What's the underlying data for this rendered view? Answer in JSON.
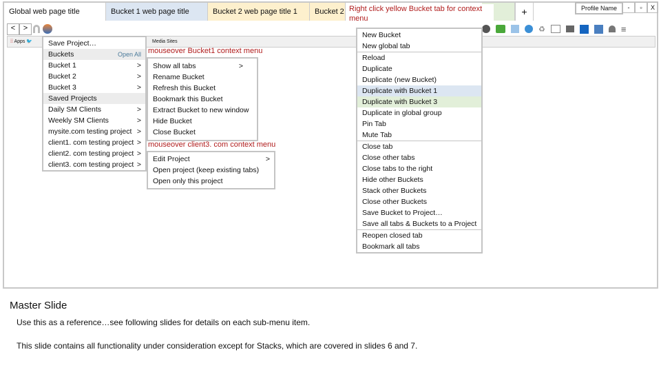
{
  "tabs": [
    {
      "label": "Global web page title",
      "color": "#ffffff"
    },
    {
      "label": "Bucket 1 web page title",
      "color": "#dce6f2"
    },
    {
      "label": "Bucket 2 web page title 1",
      "color": "#fdf0cd"
    },
    {
      "label": "Bucket 2",
      "color": "#fdf0cd"
    },
    {
      "label": "",
      "color": "#e2efd9"
    }
  ],
  "new_tab": "+",
  "window": {
    "profile": "Profile Name",
    "minimize": "-",
    "maximize": "▫",
    "close": "X"
  },
  "nav": {
    "back": "<",
    "forward": ">"
  },
  "bookmarks": {
    "apps": "Apps",
    "media": "Media Sites"
  },
  "notes": {
    "right_click": "Right click yellow Bucket tab for context menu",
    "bucket1": "mouseover Bucket1 context menu",
    "client3": "mouseover client3. com context menu"
  },
  "main_menu": {
    "save": "Save Project…",
    "buckets": "Buckets",
    "open_all": "Open All",
    "bucket_items": [
      "Bucket 1",
      "Bucket 2",
      "Bucket 3"
    ],
    "saved": "Saved Projects",
    "projects": [
      "Daily SM Clients",
      "Weekly SM Clients",
      "mysite.com testing project",
      "client1. com testing project",
      "client2. com testing project",
      "client3. com testing project"
    ],
    "arrow": ">"
  },
  "bucket_menu": [
    "Show all tabs",
    "Rename Bucket",
    "Refresh this Bucket",
    "Bookmark this Bucket",
    "Extract Bucket to new window",
    "Hide Bucket",
    "Close Bucket"
  ],
  "project_menu": [
    "Edit Project",
    "Open project (keep existing tabs)",
    "Open only this project"
  ],
  "context_menu": [
    [
      "New Bucket",
      "New global tab"
    ],
    [
      "Reload",
      "Duplicate",
      "Duplicate (new Bucket)",
      "Duplicate with Bucket 1",
      "Duplicate with Bucket 3",
      "Duplicate in global group",
      "Pin Tab",
      "Mute Tab"
    ],
    [
      "Close tab",
      "Close other tabs",
      "Close tabs to the right",
      "Hide other Buckets",
      "Stack other Buckets",
      "Close other Buckets",
      "Save Bucket to Project…",
      "Save all tabs & Buckets to a Project"
    ],
    [
      "Reopen closed tab",
      "Bookmark all tabs"
    ]
  ],
  "highlight_colors": {
    "bucket1": "#dce6f2",
    "bucket3": "#e2efd9"
  },
  "slide": {
    "title": "Master Slide",
    "line1": "Use this as a reference…see following slides for details on each sub-menu item.",
    "line2": "This slide contains all functionality under consideration except for Stacks, which are covered in slides 6 and 7."
  }
}
